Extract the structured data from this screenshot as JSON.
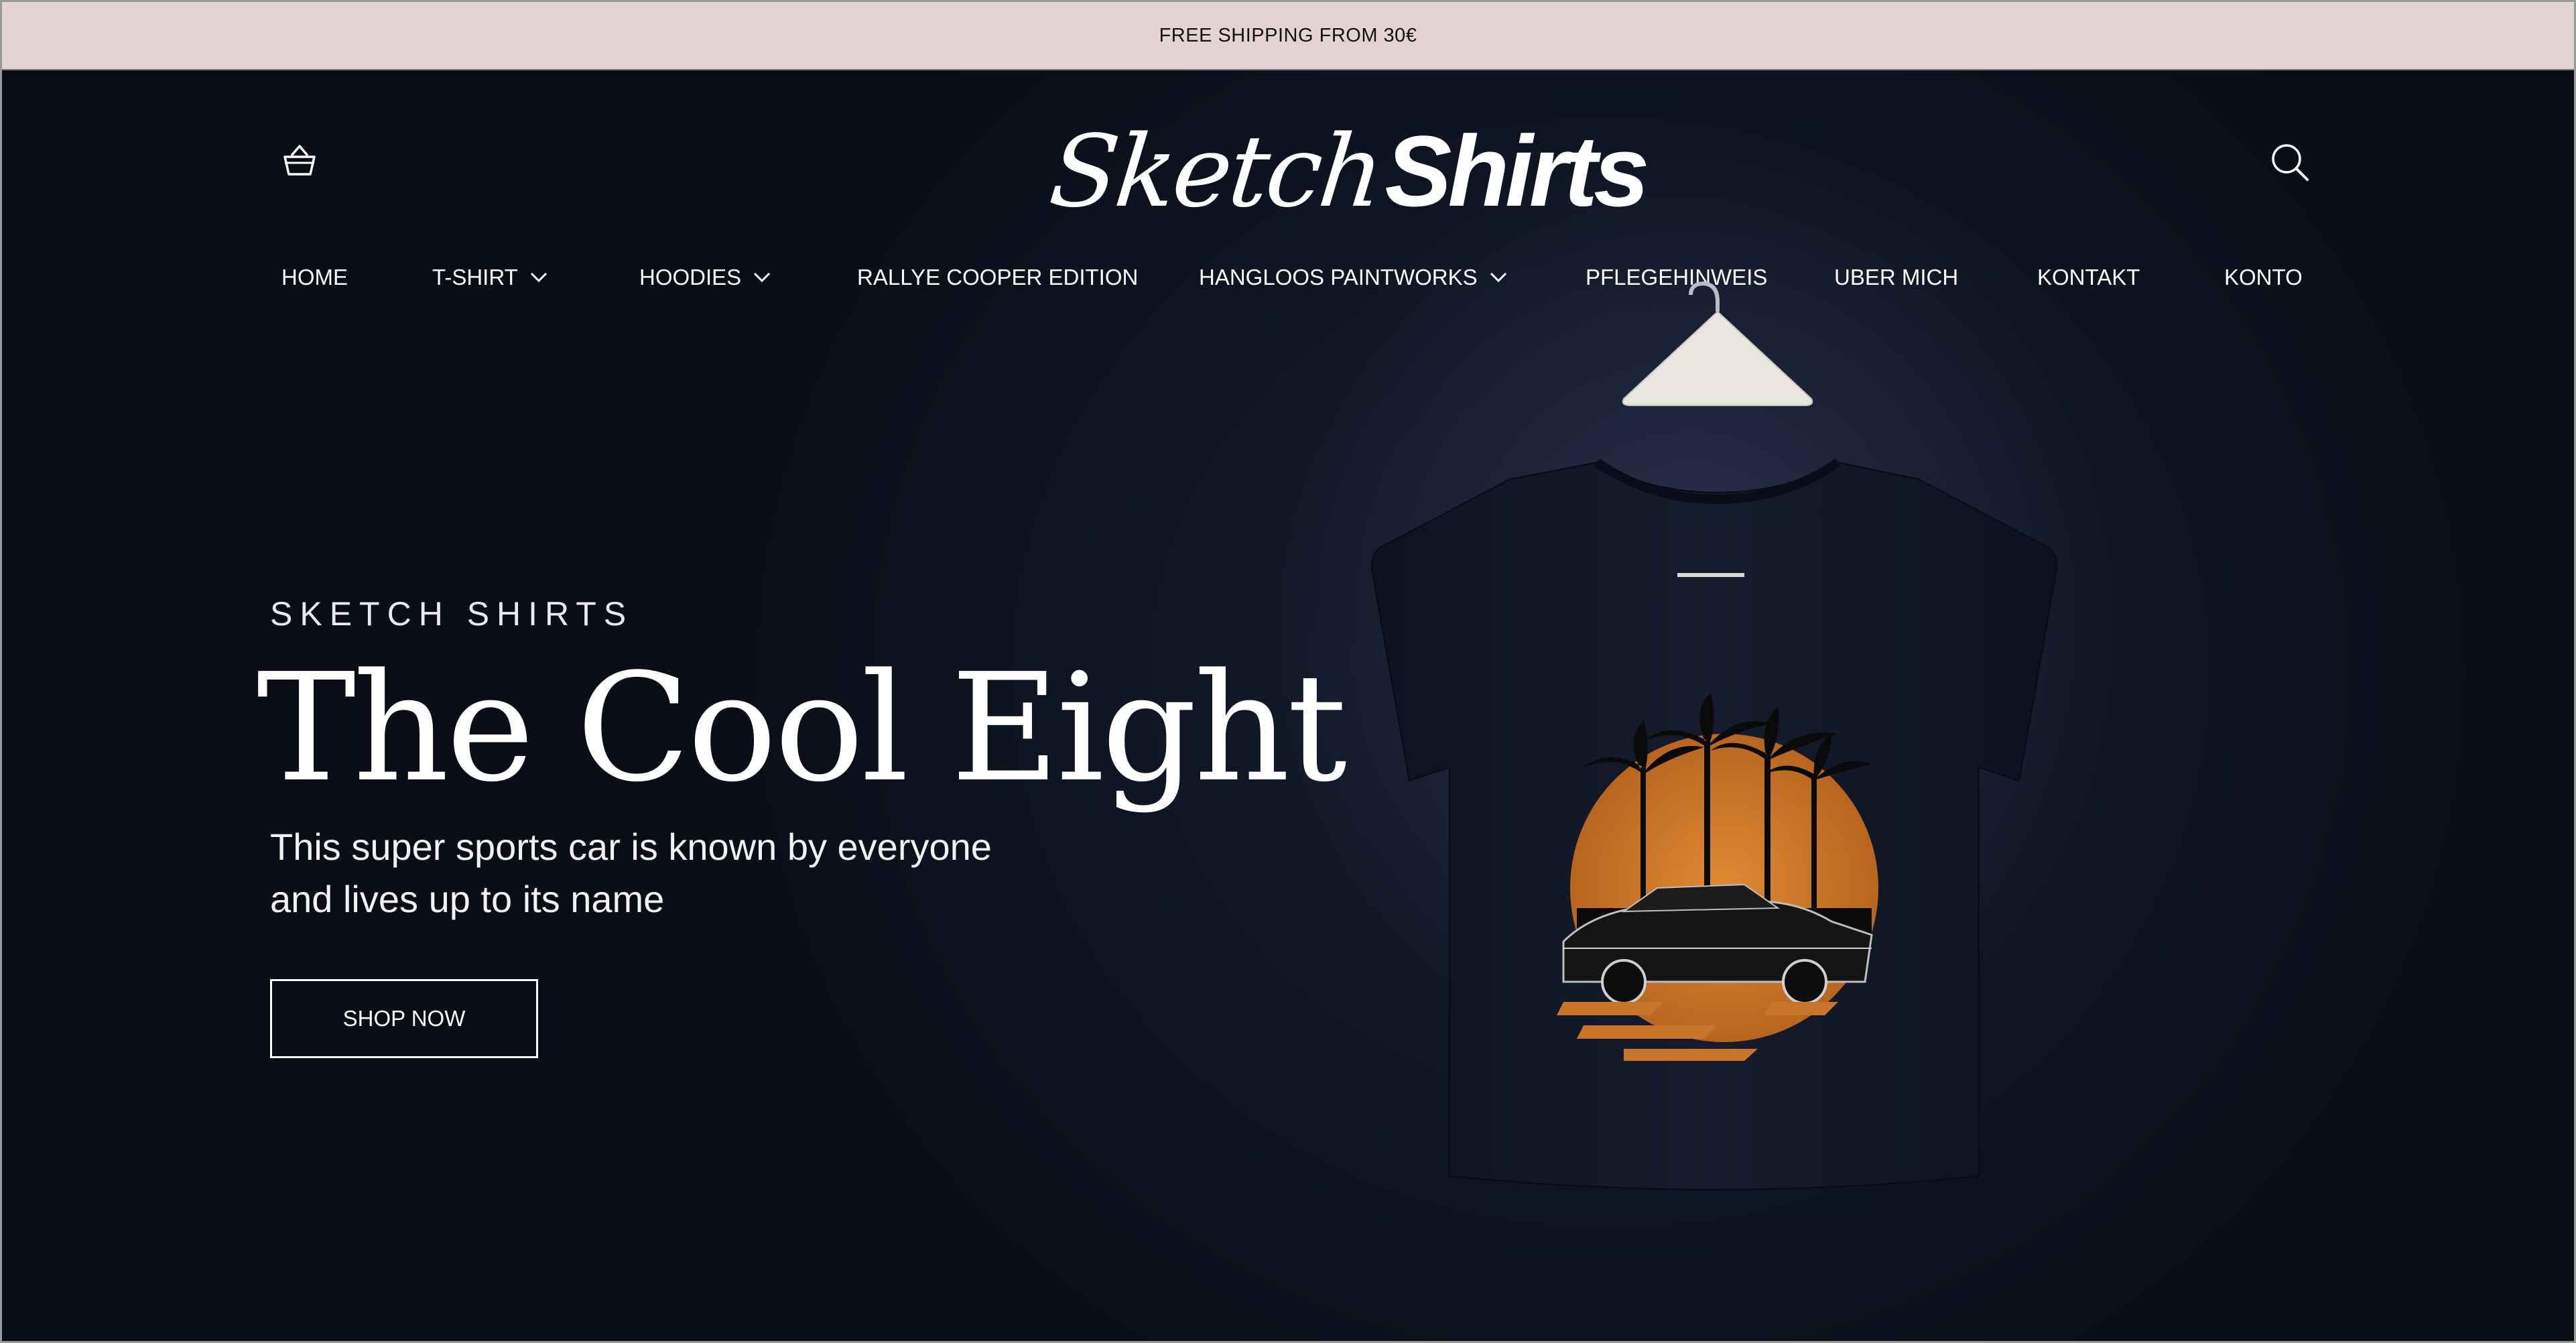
{
  "announcement": {
    "text": "FREE SHIPPING FROM 30€"
  },
  "header": {
    "logo": {
      "script_part": "Sketch",
      "bold_part": "Shirts"
    },
    "cart_icon": "basket-icon",
    "search_icon": "search-icon"
  },
  "nav": {
    "items": [
      {
        "label": "HOME",
        "has_dropdown": false
      },
      {
        "label": "T-SHIRT",
        "has_dropdown": true
      },
      {
        "label": "HOODIES",
        "has_dropdown": true
      },
      {
        "label": "RALLYE COOPER EDITION",
        "has_dropdown": false
      },
      {
        "label": "HANGLOOS PAINTWORKS",
        "has_dropdown": true
      },
      {
        "label": "PFLEGEHINWEIS",
        "has_dropdown": false
      },
      {
        "label": "UBER MICH",
        "has_dropdown": false
      },
      {
        "label": "KONTAKT",
        "has_dropdown": false
      },
      {
        "label": "KONTO",
        "has_dropdown": false
      }
    ]
  },
  "hero": {
    "eyebrow": "SKETCH SHIRTS",
    "title": "The Cool Eight",
    "subtitle_line1": "This super sports car is known by everyone",
    "subtitle_line2": "and lives up to its name",
    "cta_label": "SHOP NOW"
  },
  "colors": {
    "announcement_bg": "#e4d3d3",
    "hero_bg": "#0a0d16",
    "accent_orange": "#c8752a",
    "text_light": "#ffffff"
  }
}
